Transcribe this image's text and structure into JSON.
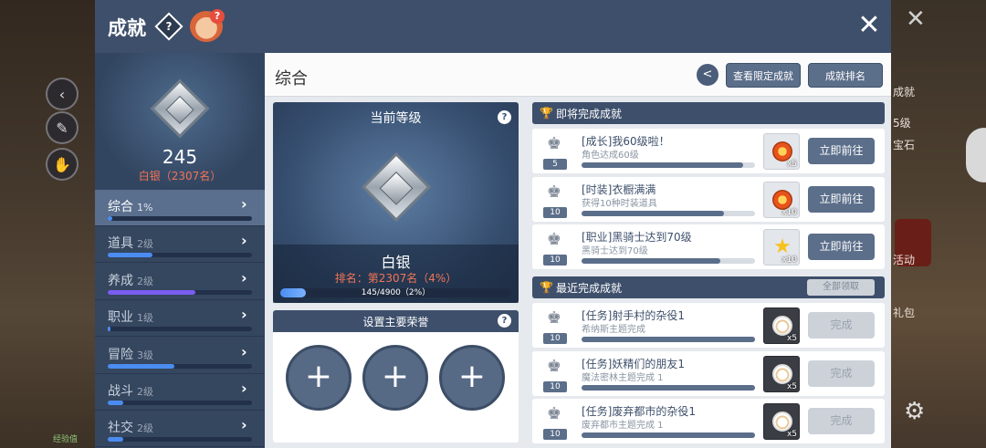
{
  "header": {
    "title": "成就",
    "help_glyph": "?",
    "mascot_badge": "?",
    "close_glyph": "✕"
  },
  "sidebar": {
    "score": "245",
    "rank_label": "白银（2307名）",
    "categories": [
      {
        "name": "综合",
        "level": "1%",
        "progress": 0.03,
        "color": "#4b8cf0",
        "active": true
      },
      {
        "name": "道具",
        "level": "2级",
        "progress": 0.31,
        "color": "#4b8cf0"
      },
      {
        "name": "养成",
        "level": "2级",
        "progress": 0.61,
        "color": "#7a5cf0"
      },
      {
        "name": "职业",
        "level": "1级",
        "progress": 0.02,
        "color": "#4b8cf0"
      },
      {
        "name": "冒险",
        "level": "3级",
        "progress": 0.46,
        "color": "#4b8cf0"
      },
      {
        "name": "战斗",
        "level": "2级",
        "progress": 0.11,
        "color": "#4b8cf0"
      },
      {
        "name": "社交",
        "level": "2级",
        "progress": 0.11,
        "color": "#4b8cf0"
      }
    ]
  },
  "main": {
    "title": "综合",
    "share_glyph": "<",
    "limited_button": "查看限定成就",
    "ranking_button": "成就排名"
  },
  "level_card": {
    "title": "当前等级",
    "help_glyph": "?",
    "name": "白银",
    "rank_text": "排名：第2307名（4%）",
    "progress_text": "145/4900（2%）",
    "progress": 0.11
  },
  "honor": {
    "title": "设置主要荣誉",
    "help_glyph": "?",
    "plus_glyph": "+"
  },
  "upcoming": {
    "title": "即将完成成就",
    "trophy_glyph": "🏆",
    "items": [
      {
        "num": "5",
        "name": "[成长]我60级啦！",
        "desc": "角色达成60级",
        "progress": 0.93,
        "qty": "x5",
        "icon": "orange-gem-icon",
        "button": "立即前往"
      },
      {
        "num": "10",
        "name": "[时装]衣橱满满",
        "desc": "获得10种时装道具",
        "progress": 0.82,
        "qty": "x10",
        "icon": "orange-gem-icon",
        "button": "立即前往"
      },
      {
        "num": "10",
        "name": "[职业]黑骑士达到70级",
        "desc": "黑骑士达到70级",
        "progress": 0.8,
        "qty": "x10",
        "icon": "gold-star-icon",
        "button": "立即前往"
      }
    ]
  },
  "recent": {
    "title": "最近完成成就",
    "trophy_glyph": "🏆",
    "claim_all": "全部领取",
    "items": [
      {
        "num": "10",
        "name": "[任务]射手村的杂役1",
        "desc": "希纳斯主题完成",
        "progress": 1.0,
        "qty": "x5",
        "icon": "pet-face-icon",
        "button": "完成"
      },
      {
        "num": "10",
        "name": "[任务]妖精们的朋友1",
        "desc": "魔法密林主题完成 1",
        "progress": 1.0,
        "qty": "x5",
        "icon": "pet-face-icon",
        "button": "完成"
      },
      {
        "num": "10",
        "name": "[任务]废弃都市的杂役1",
        "desc": "废弃都市主题完成 1",
        "progress": 1.0,
        "qty": "x5",
        "icon": "pet-face-icon",
        "button": "完成"
      }
    ]
  },
  "background": {
    "right_labels": [
      "成就",
      "5级",
      "宝石",
      "活动",
      "礼包"
    ],
    "exp_label": "经验值"
  }
}
